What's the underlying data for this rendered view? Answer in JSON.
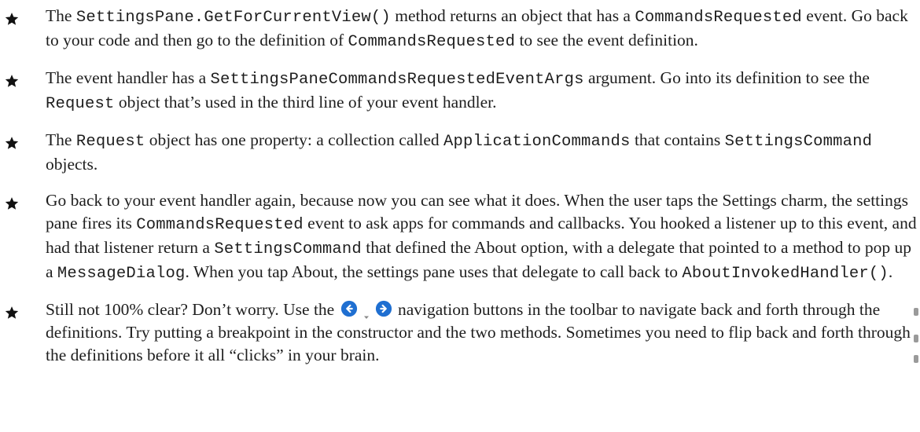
{
  "bullets": [
    {
      "segments": [
        {
          "t": "The "
        },
        {
          "c": "SettingsPane.GetForCurrentView()"
        },
        {
          "t": " method returns an object that has a "
        },
        {
          "c": "CommandsRequested"
        },
        {
          "t": " event. Go back to your code and then go to the definition of "
        },
        {
          "c": "CommandsRequested"
        },
        {
          "t": " to see the event definition."
        }
      ]
    },
    {
      "segments": [
        {
          "t": "The event handler has a "
        },
        {
          "c": "SettingsPaneCommandsRequestedEventArgs"
        },
        {
          "t": " argument. Go into its definition to see the "
        },
        {
          "c": "Request"
        },
        {
          "t": " object that’s used in the third line of your event handler."
        }
      ]
    },
    {
      "segments": [
        {
          "t": "The "
        },
        {
          "c": "Request"
        },
        {
          "t": " object has one property: a collection called "
        },
        {
          "c": "ApplicationCommands"
        },
        {
          "t": " that contains "
        },
        {
          "c": "SettingsCommand"
        },
        {
          "t": " objects."
        }
      ]
    },
    {
      "segments": [
        {
          "t": "Go back to your event handler again, because now you can see what it does. When the user taps the Settings charm, the settings pane fires its "
        },
        {
          "c": "CommandsRequested"
        },
        {
          "t": " event to ask apps for commands and callbacks. You hooked a listener up to this event, and had that listener return a "
        },
        {
          "c": "SettingsCommand"
        },
        {
          "t": " that defined the About option, with a delegate that pointed to a method to pop up a "
        },
        {
          "c": "MessageDialog"
        },
        {
          "t": ". When you tap About, the settings pane uses that delegate to call back to "
        },
        {
          "c": "AboutInvokedHandler()"
        },
        {
          "t": "."
        }
      ]
    },
    {
      "segments": [
        {
          "t": "Still not 100% clear? Don’t worry. Use the "
        },
        {
          "nav": true
        },
        {
          "t": " navigation buttons in the toolbar to navigate back and forth through the definitions. Try putting a breakpoint in the constructor and the two methods. Sometimes you need to flip back and forth through the definitions before it all “clicks” in your brain."
        }
      ]
    }
  ],
  "icons": {
    "bullet": "star-icon",
    "nav_back": "navigate-backward-icon",
    "nav_dropdown": "dropdown-arrow-icon",
    "nav_forward": "navigate-forward-icon"
  },
  "colors": {
    "text": "#1e1e1e",
    "star": "#111111",
    "nav_button": "#1f6fd1"
  }
}
